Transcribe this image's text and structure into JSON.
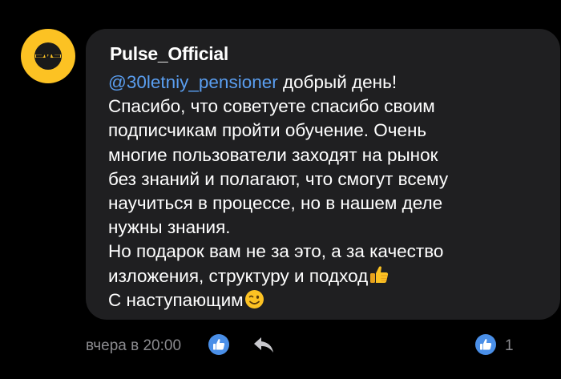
{
  "comment": {
    "author": "Pulse_Official",
    "mention": "@30letniy_pensioner",
    "lines": [
      "добрый день!",
      "Спасибо, что советуете спасибо своим",
      "подписчикам пройти обучение. Очень",
      "многие пользователи заходят на рынок",
      "без знаний и полагают, что смогут всему",
      "научиться в процессе, но в нашем деле",
      "нужны знания.",
      "Но подарок вам не за это, а за качество",
      "изложения, структуру и подход",
      "С наступающим"
    ],
    "emojis": {
      "line9": "thumbs-up-emoji",
      "line10": "winking-face-emoji"
    }
  },
  "footer": {
    "timestamp": "вчера в 20:00",
    "likes_count": "1"
  },
  "icons": {
    "avatar": "pulse-logo-icon",
    "like": "thumbs-up-icon",
    "reply": "reply-arrow-icon",
    "likes_badge": "thumbs-up-icon"
  },
  "colors": {
    "background": "#000000",
    "bubble": "#1f1f21",
    "mention": "#5a9ef0",
    "avatar_yellow": "#fcc223",
    "like_blue": "#4a8fe8",
    "muted_text": "#8a8a8e"
  }
}
